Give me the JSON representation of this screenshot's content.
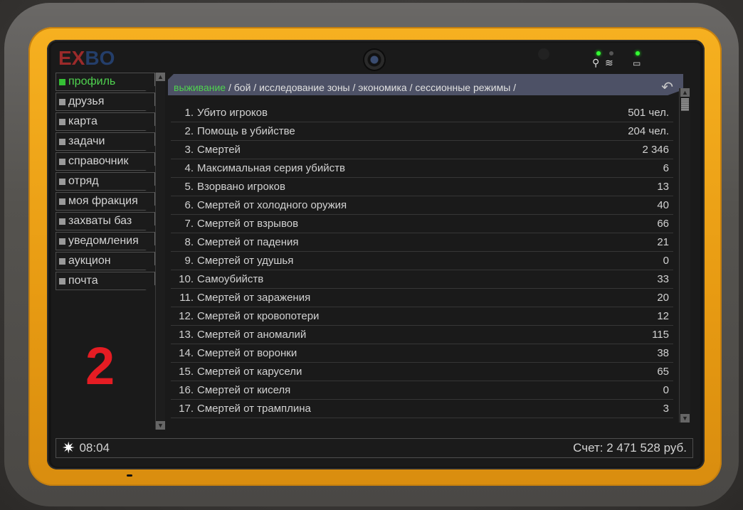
{
  "device": {
    "logo_part1": "EX",
    "logo_part2": "BO",
    "signal_icon": "antenna-icon",
    "wifi_icon": "wifi-icon",
    "battery_icon": "battery-icon"
  },
  "sidebar": {
    "items": [
      {
        "label": "профиль",
        "active": true
      },
      {
        "label": "друзья"
      },
      {
        "label": "карта"
      },
      {
        "label": "задачи"
      },
      {
        "label": "справочник"
      },
      {
        "label": "отряд"
      },
      {
        "label": "моя фракция"
      },
      {
        "label": "захваты баз"
      },
      {
        "label": "уведомления"
      },
      {
        "label": "аукцион"
      },
      {
        "label": "почта"
      }
    ]
  },
  "overlay_number": "2",
  "tabs": [
    {
      "label": "выживание",
      "active": true
    },
    {
      "label": "бой"
    },
    {
      "label": "исследование зоны"
    },
    {
      "label": "экономика"
    },
    {
      "label": "сессионные режимы"
    }
  ],
  "tab_separator": " / ",
  "tab_trailing": " /",
  "back_icon": "back-arrow-icon",
  "stats": [
    {
      "num": "1.",
      "name": "Убито игроков",
      "value": "501 чел."
    },
    {
      "num": "2.",
      "name": "Помощь в убийстве",
      "value": "204 чел."
    },
    {
      "num": "3.",
      "name": "Смертей",
      "value": "2 346"
    },
    {
      "num": "4.",
      "name": "Максимальная серия убийств",
      "value": "6"
    },
    {
      "num": "5.",
      "name": "Взорвано игроков",
      "value": "13"
    },
    {
      "num": "6.",
      "name": "Смертей от холодного оружия",
      "value": "40"
    },
    {
      "num": "7.",
      "name": "Смертей от взрывов",
      "value": "66"
    },
    {
      "num": "8.",
      "name": "Смертей от падения",
      "value": "21"
    },
    {
      "num": "9.",
      "name": "Смертей от удушья",
      "value": "0"
    },
    {
      "num": "10.",
      "name": "Самоубийств",
      "value": "33"
    },
    {
      "num": "11.",
      "name": "Смертей от заражения",
      "value": "20"
    },
    {
      "num": "12.",
      "name": "Смертей от кровопотери",
      "value": "12"
    },
    {
      "num": "13.",
      "name": "Смертей от аномалий",
      "value": "115"
    },
    {
      "num": "14.",
      "name": "Смертей от воронки",
      "value": "38"
    },
    {
      "num": "15.",
      "name": "Смертей от карусели",
      "value": "65"
    },
    {
      "num": "16.",
      "name": "Смертей от киселя",
      "value": "0"
    },
    {
      "num": "17.",
      "name": "Смертей от трамплина",
      "value": "3"
    }
  ],
  "status": {
    "sun_icon": "sun-icon",
    "time": "08:04",
    "balance": "Счет: 2 471 528 руб."
  }
}
